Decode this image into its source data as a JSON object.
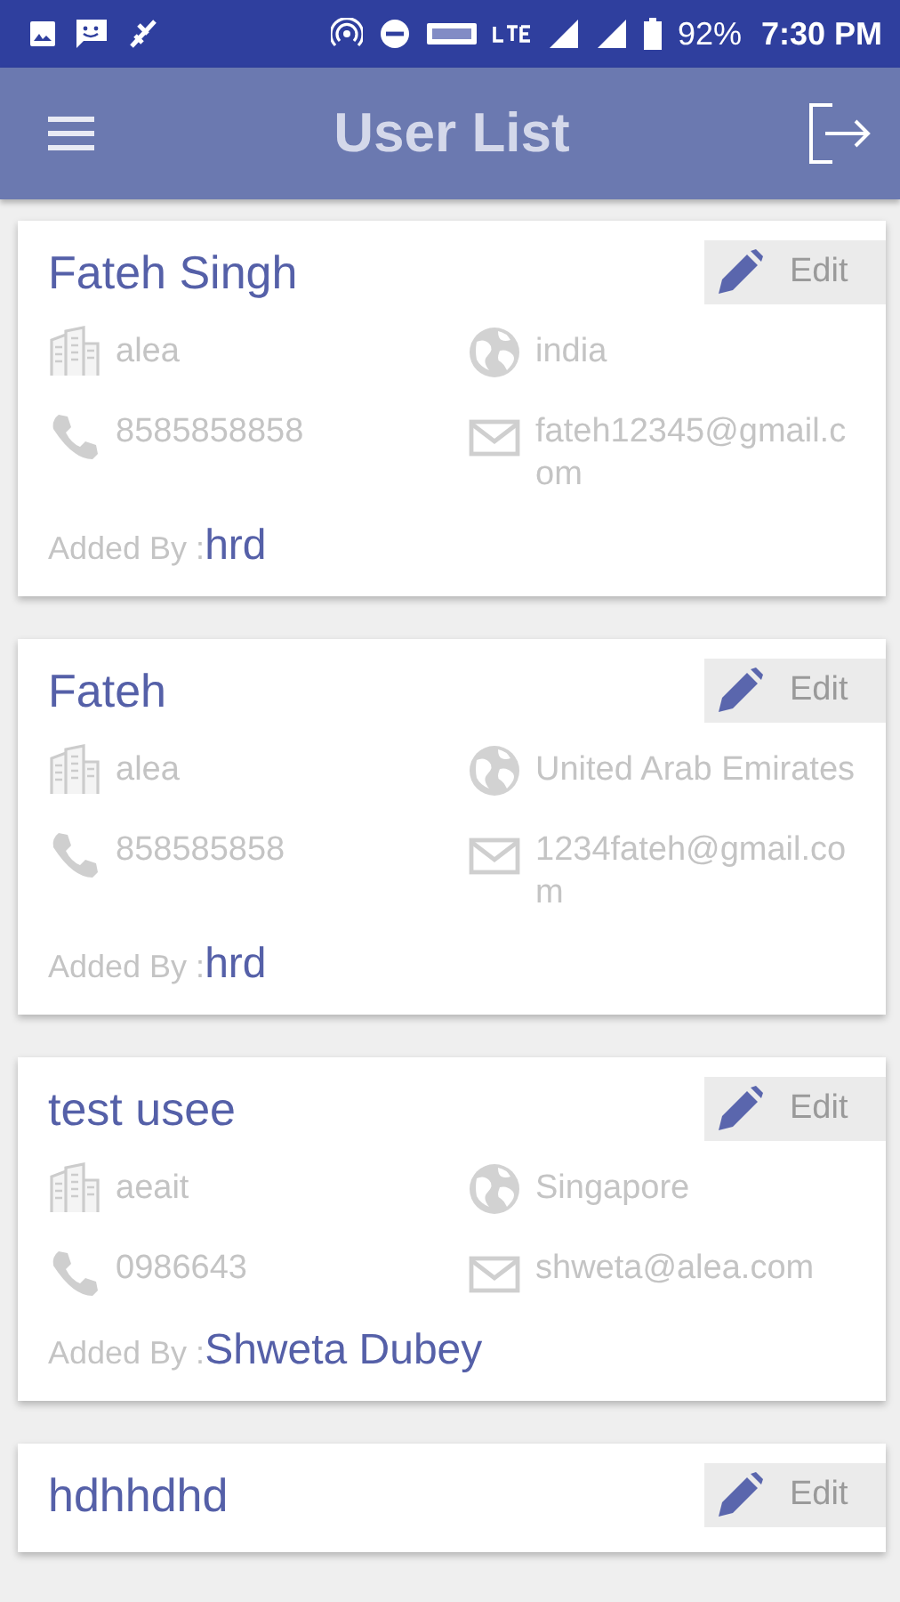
{
  "status_bar": {
    "battery": "92%",
    "time": "7:30 PM"
  },
  "app_bar": {
    "title": "User List"
  },
  "users": [
    {
      "name": "Fateh Singh",
      "edit_label": "Edit",
      "company": "alea",
      "country": "india",
      "phone": "8585858858",
      "email": "fateh12345@gmail.com",
      "added_by_label": "Added By :",
      "added_by": "hrd"
    },
    {
      "name": "Fateh",
      "edit_label": "Edit",
      "company": "alea",
      "country": "United Arab Emirates",
      "phone": "858585858",
      "email": "1234fateh@gmail.com",
      "added_by_label": "Added By :",
      "added_by": "hrd"
    },
    {
      "name": "test usee",
      "edit_label": "Edit",
      "company": "aeait",
      "country": "Singapore",
      "phone": "0986643",
      "email": "shweta@alea.com",
      "added_by_label": "Added By :",
      "added_by": "Shweta Dubey"
    },
    {
      "name": "hdhhdhd",
      "edit_label": "Edit"
    }
  ]
}
